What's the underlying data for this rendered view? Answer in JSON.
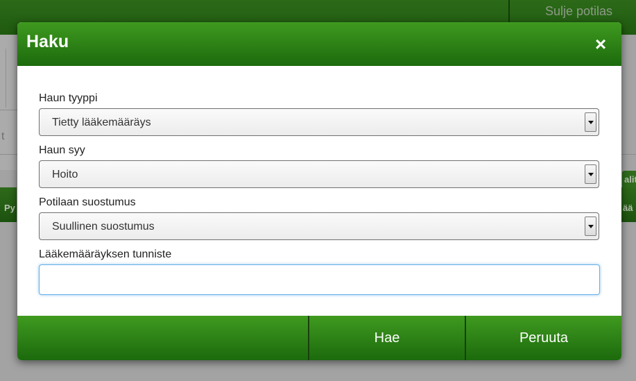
{
  "background": {
    "close_patient_label": "Sulje potilas",
    "fragment_t": "t",
    "fragment_right_top": "alit",
    "fragment_left": "Py",
    "fragment_right_bottom": "ää"
  },
  "modal": {
    "title": "Haku",
    "close_icon": "×",
    "fields": {
      "search_type": {
        "label": "Haun tyyppi",
        "value": "Tietty lääkemääräys"
      },
      "search_reason": {
        "label": "Haun syy",
        "value": "Hoito"
      },
      "patient_consent": {
        "label": "Potilaan suostumus",
        "value": "Suullinen suostumus"
      },
      "prescription_id": {
        "label": "Lääkemääräyksen tunniste",
        "value": "",
        "placeholder": ""
      }
    },
    "footer": {
      "search_label": "Hae",
      "cancel_label": "Peruuta"
    }
  },
  "colors": {
    "brand_green": "#2e7d16",
    "input_focus": "#66aee8"
  },
  "icons": {
    "close": "close-icon",
    "dropdown": "chevron-down-icon"
  }
}
